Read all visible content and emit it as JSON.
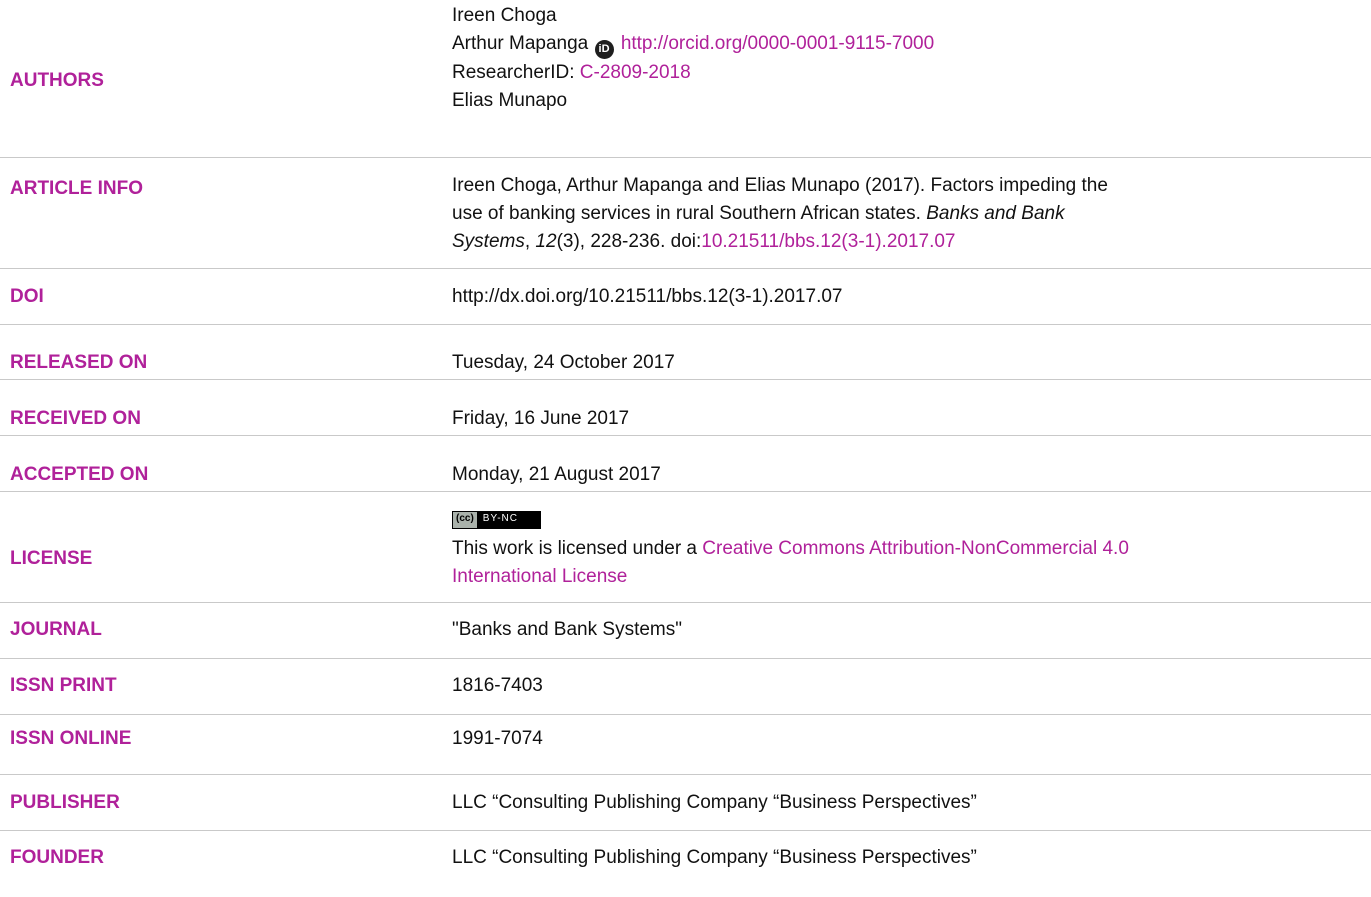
{
  "rows": {
    "authors": {
      "label": "AUTHORS",
      "names": [
        "Ireen Choga",
        "Arthur Mapanga",
        "Elias Munapo"
      ],
      "orcid_icon_text": "iD",
      "orcid_url": "http://orcid.org/0000-0001-9115-7000",
      "researcherid_label": "ResearcherID:",
      "researcherid": "C-2809-2018"
    },
    "article_info": {
      "label": "ARTICLE INFO",
      "line1": "Ireen Choga, Arthur Mapanga and Elias Munapo (2017). Factors impeding the",
      "line2": "use of banking services in rural Southern African states.",
      "journal_italic": "Banks and Bank",
      "line3_italic": "Systems",
      "line3_mid": ", ",
      "volume_italic": "12",
      "line3_end": "(3), 228-236. doi:",
      "doi_link": "10.21511/bbs.12(3-1).2017.07"
    },
    "doi": {
      "label": "DOI",
      "value": "http://dx.doi.org/10.21511/bbs.12(3-1).2017.07"
    },
    "released_on": {
      "label": "RELEASED ON",
      "value": "Tuesday, 24 October 2017"
    },
    "received_on": {
      "label": "RECEIVED ON",
      "value": "Friday, 16 June 2017"
    },
    "accepted_on": {
      "label": "ACCEPTED ON",
      "value": "Monday, 21 August 2017"
    },
    "license": {
      "label": "LICENSE",
      "badge_cc": "(cc)",
      "badge_type": "BY-NC",
      "text": "This work is licensed under a ",
      "link_line1": "Creative Commons Attribution-NonCommercial 4.0",
      "link_line2": "International License"
    },
    "journal": {
      "label": "JOURNAL",
      "value": "\"Banks and Bank Systems\""
    },
    "issn_print": {
      "label": "ISSN PRINT",
      "value": "1816-7403"
    },
    "issn_online": {
      "label": "ISSN ONLINE",
      "value": "1991-7074"
    },
    "publisher": {
      "label": "PUBLISHER",
      "value": "LLC “Consulting Publishing Company “Business Perspectives”"
    },
    "founder": {
      "label": "FOUNDER",
      "value": "LLC “Consulting Publishing Company “Business Perspectives”"
    }
  },
  "colors": {
    "label": "#b0219a",
    "link": "#b0219a",
    "text": "#111111",
    "divider": "#c9c9c9"
  }
}
